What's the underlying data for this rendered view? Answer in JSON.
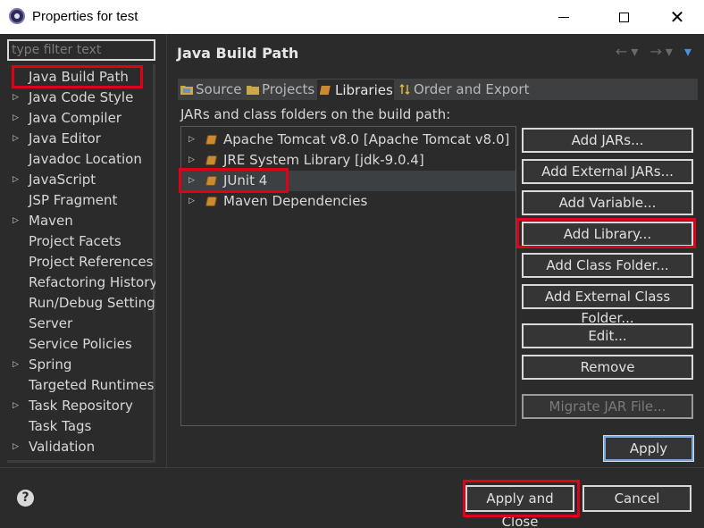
{
  "window": {
    "title": "Properties for test",
    "minimize_icon": "minimize-icon",
    "maximize_icon": "maximize-icon",
    "close_glyph": "✕"
  },
  "filter": {
    "placeholder": "type filter text"
  },
  "nav_items": [
    {
      "label": "Java Build Path",
      "expandable": false,
      "selected": true
    },
    {
      "label": "Java Code Style",
      "expandable": true
    },
    {
      "label": "Java Compiler",
      "expandable": true
    },
    {
      "label": "Java Editor",
      "expandable": true
    },
    {
      "label": "Javadoc Location",
      "expandable": false
    },
    {
      "label": "JavaScript",
      "expandable": true
    },
    {
      "label": "JSP Fragment",
      "expandable": false
    },
    {
      "label": "Maven",
      "expandable": true
    },
    {
      "label": "Project Facets",
      "expandable": false
    },
    {
      "label": "Project References",
      "expandable": false
    },
    {
      "label": "Refactoring History",
      "expandable": false
    },
    {
      "label": "Run/Debug Settings",
      "expandable": false
    },
    {
      "label": "Server",
      "expandable": false
    },
    {
      "label": "Service Policies",
      "expandable": false
    },
    {
      "label": "Spring",
      "expandable": true
    },
    {
      "label": "Targeted Runtimes",
      "expandable": false
    },
    {
      "label": "Task Repository",
      "expandable": true
    },
    {
      "label": "Task Tags",
      "expandable": false
    },
    {
      "label": "Validation",
      "expandable": true
    }
  ],
  "page": {
    "title": "Java Build Path",
    "nav_back": "←",
    "nav_forward": "→",
    "nav_menu": "▾"
  },
  "tabs": [
    {
      "label": "Source",
      "icon": "source-folder-icon",
      "active": false
    },
    {
      "label": "Projects",
      "icon": "projects-folder-icon",
      "active": false
    },
    {
      "label": "Libraries",
      "icon": "libraries-icon",
      "active": true
    },
    {
      "label": "Order and Export",
      "icon": "order-export-icon",
      "active": false
    }
  ],
  "libraries": {
    "description": "JARs and class folders on the build path:",
    "items": [
      {
        "label": "Apache Tomcat v8.0 [Apache Tomcat v8.0]"
      },
      {
        "label": "JRE System Library [jdk-9.0.4]"
      },
      {
        "label": "JUnit 4",
        "selected": true
      },
      {
        "label": "Maven Dependencies"
      }
    ]
  },
  "buttons": {
    "add_jars": "Add JARs...",
    "add_external_jars": "Add External JARs...",
    "add_variable": "Add Variable...",
    "add_library": "Add Library...",
    "add_class_folder": "Add Class Folder...",
    "add_external_class_folder": "Add External Class Folder...",
    "edit": "Edit...",
    "remove": "Remove",
    "migrate_jar": "Migrate JAR File...",
    "apply": "Apply"
  },
  "footer": {
    "help_glyph": "?",
    "apply_and_close": "Apply and Close",
    "cancel": "Cancel"
  },
  "colors": {
    "background": "#2b2b2b",
    "highlight_box": "#e0001a",
    "jar_icon": "#c98a33",
    "nav_active": "#4a8fe0"
  }
}
